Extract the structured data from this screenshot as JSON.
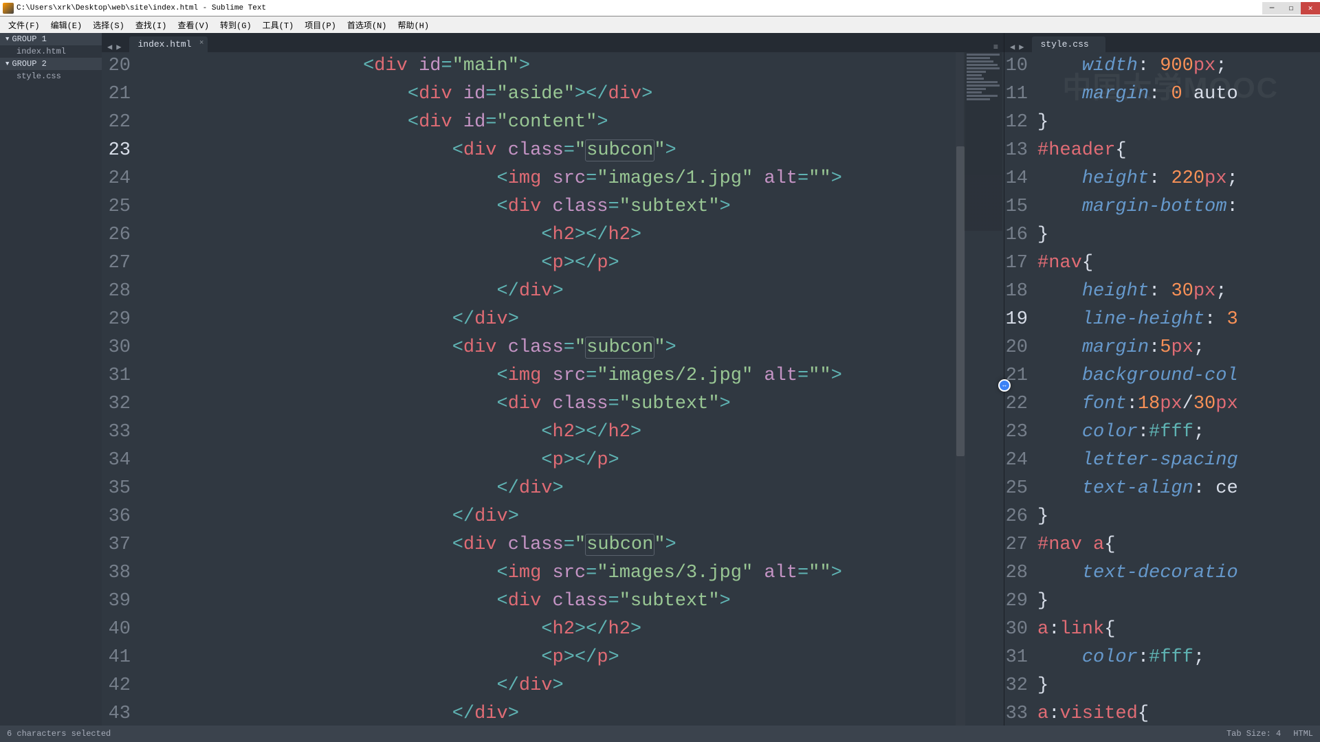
{
  "window": {
    "title": "C:\\Users\\xrk\\Desktop\\web\\site\\index.html - Sublime Text"
  },
  "menu": {
    "items": [
      "文件(F)",
      "编辑(E)",
      "选择(S)",
      "查找(I)",
      "查看(V)",
      "转到(G)",
      "工具(T)",
      "项目(P)",
      "首选项(N)",
      "帮助(H)"
    ]
  },
  "sidebar": {
    "groups": [
      {
        "label": "GROUP 1",
        "files": [
          "index.html"
        ]
      },
      {
        "label": "GROUP 2",
        "files": [
          "style.css"
        ]
      }
    ]
  },
  "panes": {
    "left": {
      "tab": "index.html",
      "first_line": 20,
      "highlighted_line": 23,
      "lines": [
        [
          [
            "sp",
            5
          ],
          [
            "p",
            "<"
          ],
          [
            "t",
            "div "
          ],
          [
            "a",
            "id"
          ],
          [
            "p",
            "="
          ],
          [
            "s",
            "\"main\""
          ],
          [
            "p",
            ">"
          ]
        ],
        [
          [
            "sp",
            6
          ],
          [
            "p",
            "<"
          ],
          [
            "t",
            "div "
          ],
          [
            "a",
            "id"
          ],
          [
            "p",
            "="
          ],
          [
            "s",
            "\"aside\""
          ],
          [
            "p",
            "></"
          ],
          [
            "t",
            "div"
          ],
          [
            "p",
            ">"
          ]
        ],
        [
          [
            "sp",
            6
          ],
          [
            "p",
            "<"
          ],
          [
            "t",
            "div "
          ],
          [
            "a",
            "id"
          ],
          [
            "p",
            "="
          ],
          [
            "s",
            "\"content\""
          ],
          [
            "p",
            ">"
          ]
        ],
        [
          [
            "sp",
            7
          ],
          [
            "p",
            "<"
          ],
          [
            "t",
            "div "
          ],
          [
            "a",
            "class"
          ],
          [
            "p",
            "="
          ],
          [
            "s",
            "\""
          ],
          [
            "box",
            "subcon"
          ],
          [
            "s",
            "\""
          ],
          [
            "p",
            ">"
          ]
        ],
        [
          [
            "sp",
            8
          ],
          [
            "p",
            "<"
          ],
          [
            "t",
            "img "
          ],
          [
            "a",
            "src"
          ],
          [
            "p",
            "="
          ],
          [
            "s",
            "\"images/1.jpg\" "
          ],
          [
            "a",
            "alt"
          ],
          [
            "p",
            "="
          ],
          [
            "s",
            "\"\""
          ],
          [
            "p",
            ">"
          ]
        ],
        [
          [
            "sp",
            8
          ],
          [
            "p",
            "<"
          ],
          [
            "t",
            "div "
          ],
          [
            "a",
            "class"
          ],
          [
            "p",
            "="
          ],
          [
            "s",
            "\"subtext\""
          ],
          [
            "p",
            ">"
          ]
        ],
        [
          [
            "sp",
            9
          ],
          [
            "p",
            "<"
          ],
          [
            "t",
            "h2"
          ],
          [
            "p",
            "></"
          ],
          [
            "t",
            "h2"
          ],
          [
            "p",
            ">"
          ]
        ],
        [
          [
            "sp",
            9
          ],
          [
            "p",
            "<"
          ],
          [
            "t",
            "p"
          ],
          [
            "p",
            "></"
          ],
          [
            "t",
            "p"
          ],
          [
            "p",
            ">"
          ]
        ],
        [
          [
            "sp",
            8
          ],
          [
            "p",
            "</"
          ],
          [
            "t",
            "div"
          ],
          [
            "p",
            ">"
          ]
        ],
        [
          [
            "sp",
            7
          ],
          [
            "p",
            "</"
          ],
          [
            "t",
            "div"
          ],
          [
            "p",
            ">"
          ]
        ],
        [
          [
            "sp",
            7
          ],
          [
            "p",
            "<"
          ],
          [
            "t",
            "div "
          ],
          [
            "a",
            "class"
          ],
          [
            "p",
            "="
          ],
          [
            "s",
            "\""
          ],
          [
            "box",
            "subcon"
          ],
          [
            "s",
            "\""
          ],
          [
            "p",
            ">"
          ]
        ],
        [
          [
            "sp",
            8
          ],
          [
            "p",
            "<"
          ],
          [
            "t",
            "img "
          ],
          [
            "a",
            "src"
          ],
          [
            "p",
            "="
          ],
          [
            "s",
            "\"images/2.jpg\" "
          ],
          [
            "a",
            "alt"
          ],
          [
            "p",
            "="
          ],
          [
            "s",
            "\"\""
          ],
          [
            "p",
            ">"
          ]
        ],
        [
          [
            "sp",
            8
          ],
          [
            "p",
            "<"
          ],
          [
            "t",
            "div "
          ],
          [
            "a",
            "class"
          ],
          [
            "p",
            "="
          ],
          [
            "s",
            "\"subtext\""
          ],
          [
            "p",
            ">"
          ]
        ],
        [
          [
            "sp",
            9
          ],
          [
            "p",
            "<"
          ],
          [
            "t",
            "h2"
          ],
          [
            "p",
            "></"
          ],
          [
            "t",
            "h2"
          ],
          [
            "p",
            ">"
          ]
        ],
        [
          [
            "sp",
            9
          ],
          [
            "p",
            "<"
          ],
          [
            "t",
            "p"
          ],
          [
            "p",
            "></"
          ],
          [
            "t",
            "p"
          ],
          [
            "p",
            ">"
          ]
        ],
        [
          [
            "sp",
            8
          ],
          [
            "p",
            "</"
          ],
          [
            "t",
            "div"
          ],
          [
            "p",
            ">"
          ]
        ],
        [
          [
            "sp",
            7
          ],
          [
            "p",
            "</"
          ],
          [
            "t",
            "div"
          ],
          [
            "p",
            ">"
          ]
        ],
        [
          [
            "sp",
            7
          ],
          [
            "p",
            "<"
          ],
          [
            "t",
            "div "
          ],
          [
            "a",
            "class"
          ],
          [
            "p",
            "="
          ],
          [
            "s",
            "\""
          ],
          [
            "box",
            "subcon"
          ],
          [
            "s",
            "\""
          ],
          [
            "p",
            ">"
          ]
        ],
        [
          [
            "sp",
            8
          ],
          [
            "p",
            "<"
          ],
          [
            "t",
            "img "
          ],
          [
            "a",
            "src"
          ],
          [
            "p",
            "="
          ],
          [
            "s",
            "\"images/3.jpg\" "
          ],
          [
            "a",
            "alt"
          ],
          [
            "p",
            "="
          ],
          [
            "s",
            "\"\""
          ],
          [
            "p",
            ">"
          ]
        ],
        [
          [
            "sp",
            8
          ],
          [
            "p",
            "<"
          ],
          [
            "t",
            "div "
          ],
          [
            "a",
            "class"
          ],
          [
            "p",
            "="
          ],
          [
            "s",
            "\"subtext\""
          ],
          [
            "p",
            ">"
          ]
        ],
        [
          [
            "sp",
            9
          ],
          [
            "p",
            "<"
          ],
          [
            "t",
            "h2"
          ],
          [
            "p",
            "></"
          ],
          [
            "t",
            "h2"
          ],
          [
            "p",
            ">"
          ]
        ],
        [
          [
            "sp",
            9
          ],
          [
            "p",
            "<"
          ],
          [
            "t",
            "p"
          ],
          [
            "p",
            "></"
          ],
          [
            "t",
            "p"
          ],
          [
            "p",
            ">"
          ]
        ],
        [
          [
            "sp",
            8
          ],
          [
            "p",
            "</"
          ],
          [
            "t",
            "div"
          ],
          [
            "p",
            ">"
          ]
        ],
        [
          [
            "sp",
            7
          ],
          [
            "p",
            "</"
          ],
          [
            "t",
            "div"
          ],
          [
            "p",
            ">"
          ]
        ]
      ]
    },
    "right": {
      "tab": "style.css",
      "first_line": 10,
      "highlighted_line": 19,
      "lines": [
        [
          [
            "sp",
            1
          ],
          [
            "pr",
            "width"
          ],
          [
            "cp",
            ": "
          ],
          [
            "n",
            "900"
          ],
          [
            "t",
            "px"
          ],
          [
            "cp",
            ";"
          ]
        ],
        [
          [
            "sp",
            1
          ],
          [
            "pr",
            "margin"
          ],
          [
            "cp",
            ": "
          ],
          [
            "n",
            "0"
          ],
          [
            "txt",
            " auto"
          ]
        ],
        [
          [
            "cp",
            "}"
          ]
        ],
        [
          [
            "sel",
            "#header"
          ],
          [
            "cp",
            "{"
          ]
        ],
        [
          [
            "sp",
            1
          ],
          [
            "pr",
            "height"
          ],
          [
            "cp",
            ": "
          ],
          [
            "n",
            "220"
          ],
          [
            "t",
            "px"
          ],
          [
            "cp",
            ";"
          ]
        ],
        [
          [
            "sp",
            1
          ],
          [
            "pr",
            "margin-bottom"
          ],
          [
            "cp",
            ":"
          ]
        ],
        [
          [
            "cp",
            "}"
          ]
        ],
        [
          [
            "sel",
            "#nav"
          ],
          [
            "cp",
            "{"
          ]
        ],
        [
          [
            "sp",
            1
          ],
          [
            "pr",
            "height"
          ],
          [
            "cp",
            ": "
          ],
          [
            "n",
            "30"
          ],
          [
            "t",
            "px"
          ],
          [
            "cp",
            ";"
          ]
        ],
        [
          [
            "sp",
            1
          ],
          [
            "pr",
            "line-height"
          ],
          [
            "cp",
            ": "
          ],
          [
            "n",
            "3"
          ]
        ],
        [
          [
            "sp",
            1
          ],
          [
            "pr",
            "margin"
          ],
          [
            "cp",
            ":"
          ],
          [
            "n",
            "5"
          ],
          [
            "t",
            "px"
          ],
          [
            "cp",
            ";"
          ]
        ],
        [
          [
            "sp",
            1
          ],
          [
            "pr",
            "background-col"
          ]
        ],
        [
          [
            "sp",
            1
          ],
          [
            "pr",
            "font"
          ],
          [
            "cp",
            ":"
          ],
          [
            "n",
            "18"
          ],
          [
            "t",
            "px"
          ],
          [
            "cp",
            "/"
          ],
          [
            "n",
            "30"
          ],
          [
            "t",
            "px"
          ]
        ],
        [
          [
            "sp",
            1
          ],
          [
            "pr",
            "color"
          ],
          [
            "cp",
            ":"
          ],
          [
            "hex",
            "#fff"
          ],
          [
            "cp",
            ";"
          ]
        ],
        [
          [
            "sp",
            1
          ],
          [
            "pr",
            "letter-spacing"
          ]
        ],
        [
          [
            "sp",
            1
          ],
          [
            "pr",
            "text-align"
          ],
          [
            "cp",
            ": "
          ],
          [
            "txt",
            "ce"
          ]
        ],
        [
          [
            "cp",
            "}"
          ]
        ],
        [
          [
            "sel",
            "#nav "
          ],
          [
            "sel2",
            "a"
          ],
          [
            "cp",
            "{"
          ]
        ],
        [
          [
            "sp",
            1
          ],
          [
            "pr",
            "text-decoratio"
          ]
        ],
        [
          [
            "cp",
            "}"
          ]
        ],
        [
          [
            "sel2",
            "a"
          ],
          [
            "cp",
            ":"
          ],
          [
            "sel",
            "link"
          ],
          [
            "cp",
            "{"
          ]
        ],
        [
          [
            "sp",
            1
          ],
          [
            "pr",
            "color"
          ],
          [
            "cp",
            ":"
          ],
          [
            "hex",
            "#fff"
          ],
          [
            "cp",
            ";"
          ]
        ],
        [
          [
            "cp",
            "}"
          ]
        ],
        [
          [
            "sel2",
            "a"
          ],
          [
            "cp",
            ":"
          ],
          [
            "sel",
            "visited"
          ],
          [
            "cp",
            "{"
          ]
        ]
      ]
    }
  },
  "status": {
    "left": "6 characters selected",
    "tabsize": "Tab Size: 4",
    "syntax": "HTML"
  },
  "watermark": "中国大学MOOC"
}
